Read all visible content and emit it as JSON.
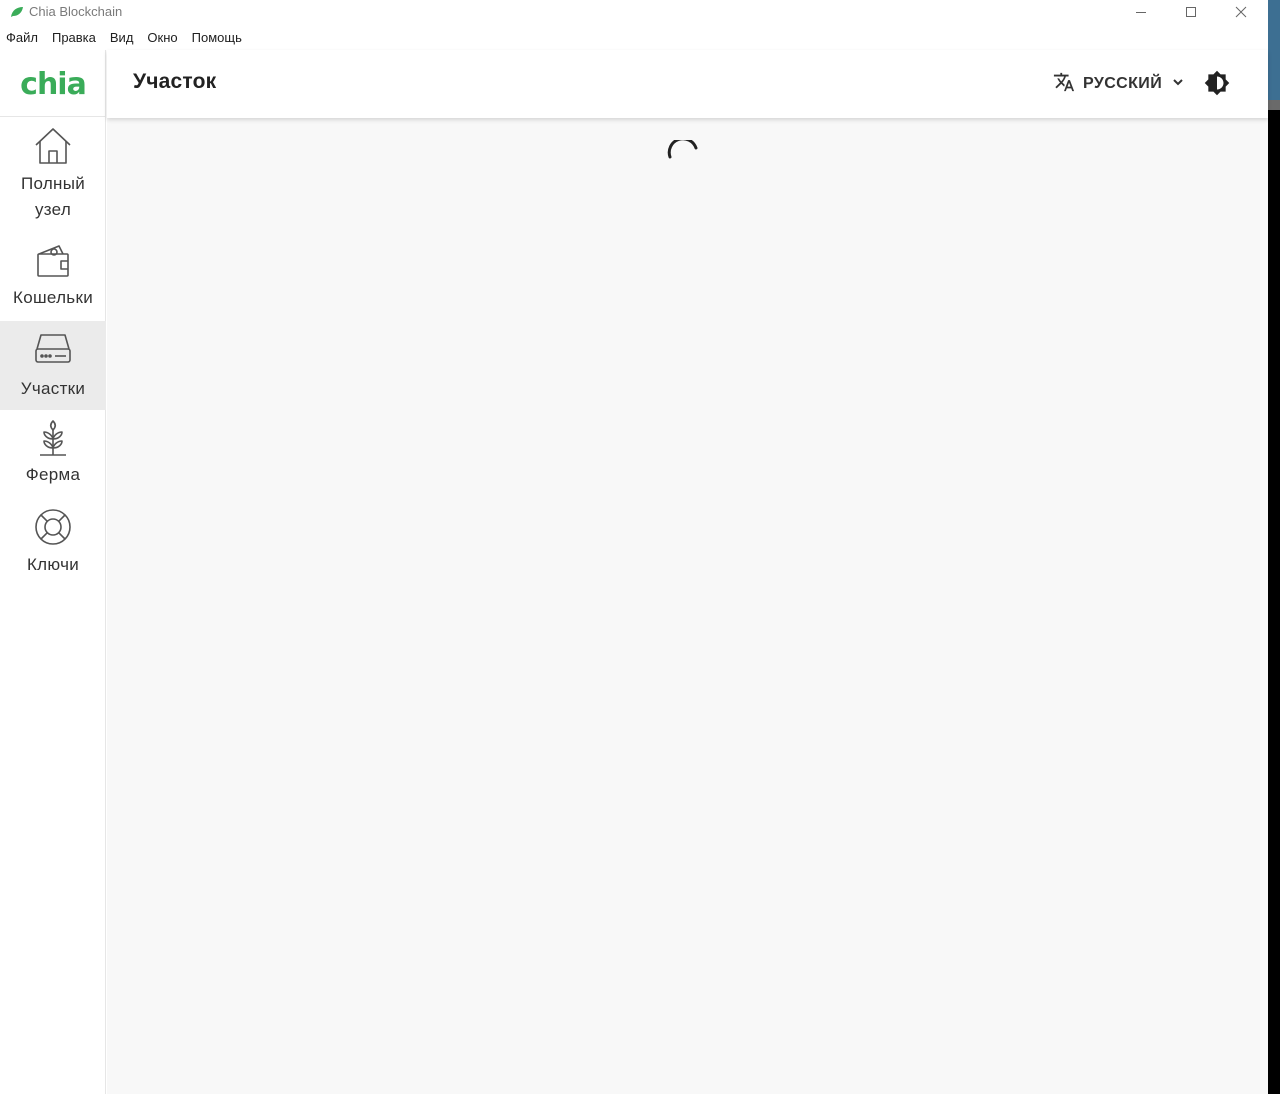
{
  "window": {
    "title": "Chia Blockchain"
  },
  "menubar": {
    "items": [
      "Файл",
      "Правка",
      "Вид",
      "Окно",
      "Помощь"
    ]
  },
  "sidebar": {
    "logo_text": "chia",
    "items": [
      {
        "label_line1": "Полный",
        "label_line2": "узел",
        "icon": "home-icon"
      },
      {
        "label_line1": "Кошельки",
        "icon": "wallet-icon"
      },
      {
        "label_line1": "Участки",
        "icon": "hard-drive-icon",
        "selected": true
      },
      {
        "label_line1": "Ферма",
        "icon": "plant-icon"
      },
      {
        "label_line1": "Ключи",
        "icon": "lifebuoy-icon"
      }
    ]
  },
  "header": {
    "title": "Участок",
    "language_label": "РУССКИЙ"
  },
  "colors": {
    "brand_green": "#3aac59",
    "selected_bg": "#ebebeb",
    "content_bg": "#f8f8f8"
  }
}
